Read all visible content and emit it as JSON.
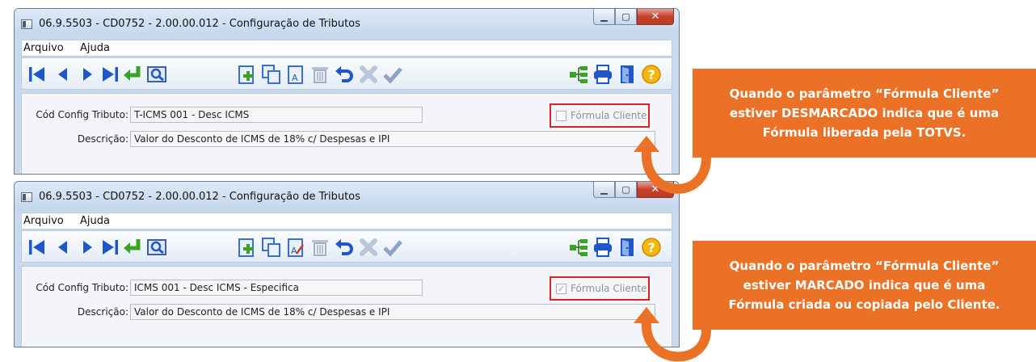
{
  "windows": [
    {
      "title": "06.9.5503 - CD0752 - 2.00.00.012 - Configuração de Tributos",
      "menu": [
        "Arquivo",
        "Ajuda"
      ],
      "cod_label": "Cód Config Tributo:",
      "cod_value": "T-ICMS 001 - Desc ICMS",
      "desc_label": "Descrição:",
      "desc_value": "Valor do Desconto de ICMS de 18% c/ Despesas e IPI",
      "checkbox_label": "Fórmula Cliente",
      "checkbox_checked": false
    },
    {
      "title": "06.9.5503 - CD0752 - 2.00.00.012 - Configuração de Tributos",
      "menu": [
        "Arquivo",
        "Ajuda"
      ],
      "cod_label": "Cód Config Tributo:",
      "cod_value": "ICMS 001 - Desc ICMS - Especifica",
      "desc_label": "Descrição:",
      "desc_value": "Valor do Desconto de ICMS de 18% c/ Despesas e IPI",
      "checkbox_label": "Fórmula Cliente",
      "checkbox_checked": true
    }
  ],
  "callouts": [
    {
      "lines": [
        "Quando o parâmetro “Fórmula Cliente”",
        "estiver DESMARCADO indica que é uma",
        "Fórmula liberada pela TOTVS."
      ]
    },
    {
      "lines": [
        "Quando o parâmetro “Fórmula Cliente”",
        "estiver MARCADO indica que é uma",
        "Fórmula criada ou copiada pelo Cliente."
      ]
    }
  ],
  "colors": {
    "callout": "#ea7125",
    "highlight_border": "#e2202a",
    "toolbar_icon": "#1f56c9"
  },
  "toolbar_icons": [
    "first-icon",
    "previous-icon",
    "next-icon",
    "last-icon",
    "goto-icon",
    "search-icon",
    "new-icon",
    "copy-icon",
    "edit-icon",
    "delete-icon",
    "undo-icon",
    "cancel-icon",
    "confirm-icon",
    "tree-icon",
    "print-icon",
    "exit-icon",
    "help-icon"
  ]
}
